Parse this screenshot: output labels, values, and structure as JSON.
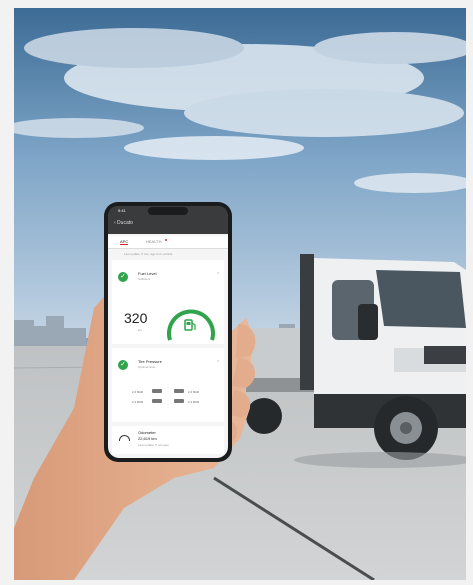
{
  "phone": {
    "status_time": "9:41",
    "header_title": "‹ Ducato",
    "tabs": [
      {
        "label": "APC"
      },
      {
        "label": "HEALTH"
      }
    ],
    "last_update_note": "Last update: 5 min. ago from vehicle",
    "cards": {
      "fuel": {
        "title": "Fuel Level",
        "subtitle": "Sufficient",
        "value": "320",
        "unit": "km",
        "level": 0.75
      },
      "tire": {
        "title": "Tire Pressure",
        "subtitle": "Optimal level",
        "readings": [
          "2.2 BAR",
          "2.2 BAR",
          "2.2 BAR",
          "2.2 BAR"
        ]
      },
      "odometer": {
        "title": "Odometer",
        "value": "22,619 km",
        "subtitle": "Last update: 5 min ago"
      }
    }
  },
  "colors": {
    "sky_top": "#3f6f99",
    "sky_bottom": "#b7cce0",
    "truck_body": "#eef0f2",
    "ok_green": "#2fa44a",
    "accent_red": "#e0202a"
  }
}
